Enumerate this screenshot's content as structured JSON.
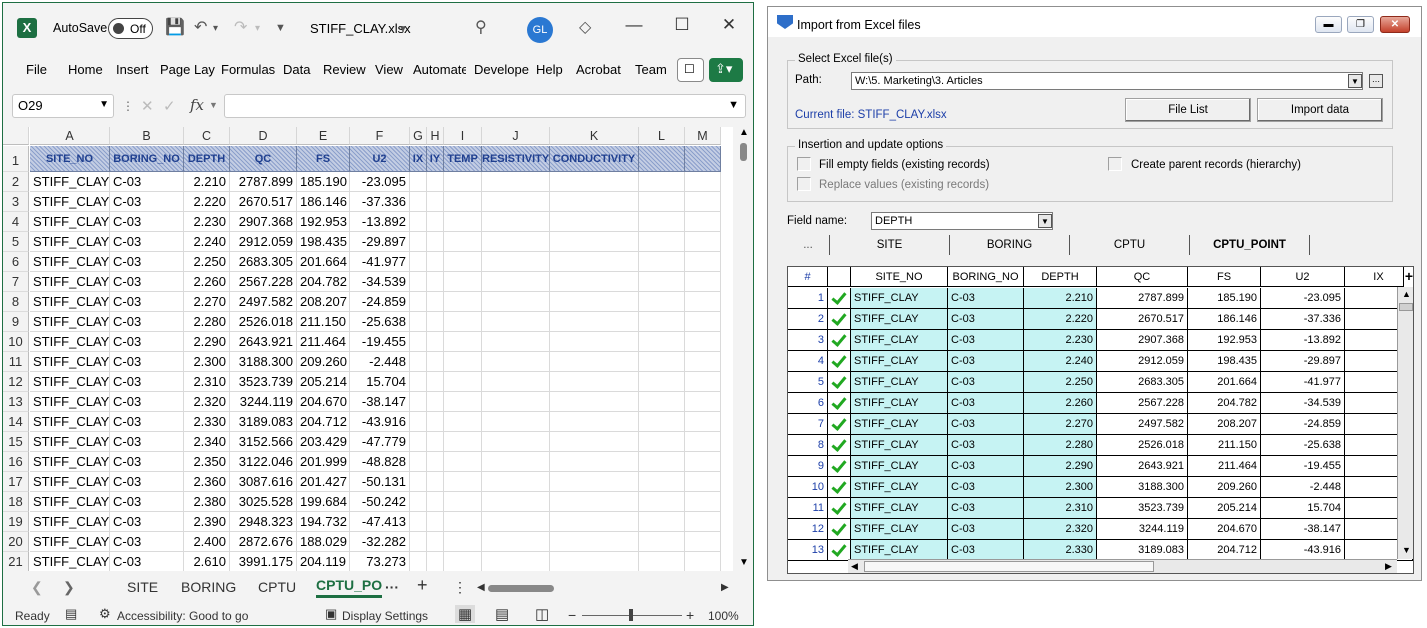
{
  "excel": {
    "autosave_label": "AutoSave",
    "autosave_state": "Off",
    "file_name": "STIFF_CLAY.xlsx",
    "avatar": "GL",
    "ribbon_tabs": [
      "File",
      "Home",
      "Insert",
      "Page Lay",
      "Formulas",
      "Data",
      "Review",
      "View",
      "Automate",
      "Develope",
      "Help",
      "Acrobat",
      "Team"
    ],
    "name_box": "O29",
    "fx": "fx",
    "columns": [
      "A",
      "B",
      "C",
      "D",
      "E",
      "F",
      "G",
      "H",
      "I",
      "J",
      "K",
      "L",
      "M"
    ],
    "header_row": [
      "SITE_NO",
      "BORING_NO",
      "DEPTH",
      "QC",
      "FS",
      "U2",
      "IX",
      "IY",
      "TEMP",
      "RESISTIVITY",
      "CONDUCTIVITY",
      "",
      ""
    ],
    "rows": [
      [
        "STIFF_CLAY",
        "C-03",
        "2.210",
        "2787.899",
        "185.190",
        "-23.095"
      ],
      [
        "STIFF_CLAY",
        "C-03",
        "2.220",
        "2670.517",
        "186.146",
        "-37.336"
      ],
      [
        "STIFF_CLAY",
        "C-03",
        "2.230",
        "2907.368",
        "192.953",
        "-13.892"
      ],
      [
        "STIFF_CLAY",
        "C-03",
        "2.240",
        "2912.059",
        "198.435",
        "-29.897"
      ],
      [
        "STIFF_CLAY",
        "C-03",
        "2.250",
        "2683.305",
        "201.664",
        "-41.977"
      ],
      [
        "STIFF_CLAY",
        "C-03",
        "2.260",
        "2567.228",
        "204.782",
        "-34.539"
      ],
      [
        "STIFF_CLAY",
        "C-03",
        "2.270",
        "2497.582",
        "208.207",
        "-24.859"
      ],
      [
        "STIFF_CLAY",
        "C-03",
        "2.280",
        "2526.018",
        "211.150",
        "-25.638"
      ],
      [
        "STIFF_CLAY",
        "C-03",
        "2.290",
        "2643.921",
        "211.464",
        "-19.455"
      ],
      [
        "STIFF_CLAY",
        "C-03",
        "2.300",
        "3188.300",
        "209.260",
        "-2.448"
      ],
      [
        "STIFF_CLAY",
        "C-03",
        "2.310",
        "3523.739",
        "205.214",
        "15.704"
      ],
      [
        "STIFF_CLAY",
        "C-03",
        "2.320",
        "3244.119",
        "204.670",
        "-38.147"
      ],
      [
        "STIFF_CLAY",
        "C-03",
        "2.330",
        "3189.083",
        "204.712",
        "-43.916"
      ],
      [
        "STIFF_CLAY",
        "C-03",
        "2.340",
        "3152.566",
        "203.429",
        "-47.779"
      ],
      [
        "STIFF_CLAY",
        "C-03",
        "2.350",
        "3122.046",
        "201.999",
        "-48.828"
      ],
      [
        "STIFF_CLAY",
        "C-03",
        "2.360",
        "3087.616",
        "201.427",
        "-50.131"
      ],
      [
        "STIFF_CLAY",
        "C-03",
        "2.380",
        "3025.528",
        "199.684",
        "-50.242"
      ],
      [
        "STIFF_CLAY",
        "C-03",
        "2.390",
        "2948.323",
        "194.732",
        "-47.413"
      ],
      [
        "STIFF_CLAY",
        "C-03",
        "2.400",
        "2872.676",
        "188.029",
        "-32.282"
      ],
      [
        "STIFF_CLAY",
        "C-03",
        "2.610",
        "3991.175",
        "204.119",
        "73.273"
      ]
    ],
    "sheet_tabs": [
      "SITE",
      "BORING",
      "CPTU",
      "CPTU_PO"
    ],
    "more_tabs": "···",
    "add_tab": "+",
    "status_ready": "Ready",
    "accessibility": "Accessibility: Good to go",
    "display_settings": "Display Settings",
    "zoom": "100%",
    "zoom_minus": "−",
    "zoom_plus": "+"
  },
  "dialog": {
    "title": "Import from Excel files",
    "select_group": "Select Excel file(s)",
    "path_label": "Path:",
    "path_value": "W:\\5. Marketing\\3. Articles",
    "current_file": "Current file: STIFF_CLAY.xlsx",
    "file_list_button": "File List",
    "import_button": "Import data",
    "insert_group": "Insertion and update options",
    "opt_fill_empty": "Fill empty fields (existing records)",
    "opt_create_parent": "Create parent records (hierarchy)",
    "opt_replace": "Replace values (existing records)",
    "field_name_label": "Field name:",
    "field_name_value": "DEPTH",
    "table_tabs": [
      "...",
      "SITE",
      "BORING",
      "CPTU",
      "CPTU_POINT"
    ],
    "grid_headers": [
      "#",
      "",
      "SITE_NO",
      "BORING_NO",
      "DEPTH",
      "QC",
      "FS",
      "U2",
      "IX"
    ],
    "grid_rows": [
      [
        "1",
        "STIFF_CLAY",
        "C-03",
        "2.210",
        "2787.899",
        "185.190",
        "-23.095"
      ],
      [
        "2",
        "STIFF_CLAY",
        "C-03",
        "2.220",
        "2670.517",
        "186.146",
        "-37.336"
      ],
      [
        "3",
        "STIFF_CLAY",
        "C-03",
        "2.230",
        "2907.368",
        "192.953",
        "-13.892"
      ],
      [
        "4",
        "STIFF_CLAY",
        "C-03",
        "2.240",
        "2912.059",
        "198.435",
        "-29.897"
      ],
      [
        "5",
        "STIFF_CLAY",
        "C-03",
        "2.250",
        "2683.305",
        "201.664",
        "-41.977"
      ],
      [
        "6",
        "STIFF_CLAY",
        "C-03",
        "2.260",
        "2567.228",
        "204.782",
        "-34.539"
      ],
      [
        "7",
        "STIFF_CLAY",
        "C-03",
        "2.270",
        "2497.582",
        "208.207",
        "-24.859"
      ],
      [
        "8",
        "STIFF_CLAY",
        "C-03",
        "2.280",
        "2526.018",
        "211.150",
        "-25.638"
      ],
      [
        "9",
        "STIFF_CLAY",
        "C-03",
        "2.290",
        "2643.921",
        "211.464",
        "-19.455"
      ],
      [
        "10",
        "STIFF_CLAY",
        "C-03",
        "2.300",
        "3188.300",
        "209.260",
        "-2.448"
      ],
      [
        "11",
        "STIFF_CLAY",
        "C-03",
        "2.310",
        "3523.739",
        "205.214",
        "15.704"
      ],
      [
        "12",
        "STIFF_CLAY",
        "C-03",
        "2.320",
        "3244.119",
        "204.670",
        "-38.147"
      ],
      [
        "13",
        "STIFF_CLAY",
        "C-03",
        "2.330",
        "3189.083",
        "204.712",
        "-43.916"
      ]
    ]
  }
}
